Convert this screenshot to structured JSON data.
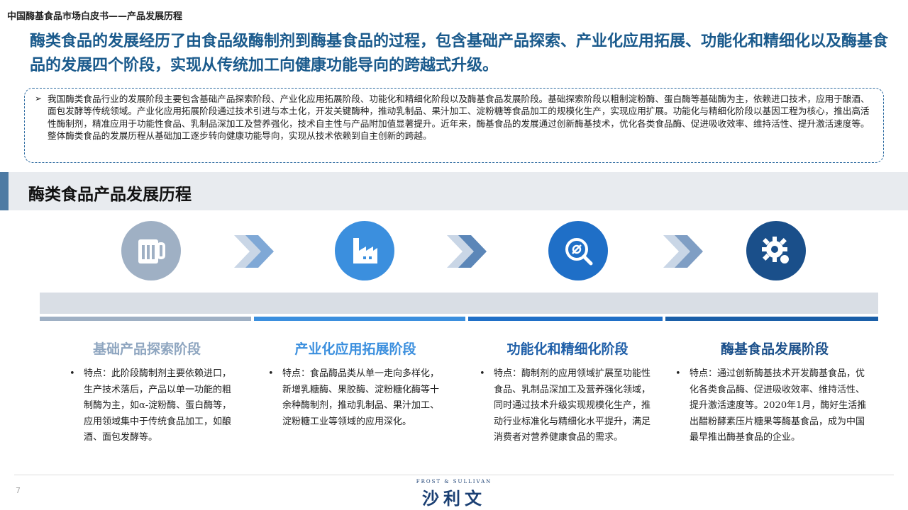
{
  "header": {
    "doc_title": "中国酶基食品市场白皮书——产品发展历程",
    "headline": "酶类食品的发展经历了由食品级酶制剂到酶基食品的过程，包含基础产品探索、产业化应用拓展、功能化和精细化以及酶基食品的发展四个阶段，实现从传统加工向健康功能导向的跨越式升级。"
  },
  "summary": {
    "arrow": "➢",
    "text": "我国酶类食品行业的发展阶段主要包含基础产品探索阶段、产业化应用拓展阶段、功能化和精细化阶段以及酶基食品发展阶段。基础探索阶段以粗制淀粉酶、蛋白酶等基础酶为主，依赖进口技术，应用于酿酒、面包发酵等传统领域。产业化应用拓展阶段通过技术引进与本土化，开发关键酶种，推动乳制品、果汁加工、淀粉糖等食品加工的规模化生产，实现应用扩展。功能化与精细化阶段以基因工程为核心，推出高活性酶制剂，精准应用于功能性食品、乳制品深加工及营养强化，技术自主性与产品附加值显著提升。近年来，酶基食品的发展通过创新酶基技术，优化各类食品酶、促进吸收效率、维持活性、提升激活速度等。整体酶类食品的发展历程从基础加工逐步转向健康功能导向，实现从技术依赖到自主创新的跨越。"
  },
  "section": {
    "title": "酶类食品产品发展历程"
  },
  "stages": [
    {
      "icon": "beer-mug-icon",
      "color": "#9fb0c4",
      "line_color": "#9fb0c4",
      "title": "基础产品探索阶段",
      "title_color": "#8fa6c0",
      "bullet": "•",
      "body": "特点：此阶段酶制剂主要依赖进口，生产技术落后，产品以单一功能的粗制酶为主，如α-淀粉酶、蛋白酶等，应用领域集中于传统食品加工，如酿酒、面包发酵等。"
    },
    {
      "icon": "factory-icon",
      "color": "#3b8fde",
      "line_color": "#3b8fde",
      "title": "产业化应用拓展阶段",
      "title_color": "#3b8fde",
      "bullet": "•",
      "body": "特点：食品酶品类从单一走向多样化，新增乳糖酶、果胶酶、淀粉糖化酶等十余种酶制剂，推动乳制品、果汁加工、淀粉糖工业等领域的应用深化。"
    },
    {
      "icon": "magnifier-icon",
      "color": "#1f6fc7",
      "line_color": "#1f6fc7",
      "title": "功能化和精细化阶段",
      "title_color": "#1f5fa8",
      "bullet": "•",
      "body": "特点：酶制剂的应用领域扩展至功能性食品、乳制品深加工及营养强化领域，同时通过技术升级实现规模化生产，推动行业标准化与精细化水平提升，满足消费者对营养健康食品的需求。"
    },
    {
      "icon": "gear-icon",
      "color": "#1a4f8a",
      "line_color": "#1a5fa8",
      "title": "酶基食品发展阶段",
      "title_color": "#1a4f8a",
      "bullet": "•",
      "body": "特点：通过创新酶基技术开发酶基食品，优化各类食品酶、促进吸收效率、维持活性、提升激活速度等。2020年1月，酶好生活推出醋粉酵素压片糖果等酶基食品，成为中国最早推出酶基食品的企业。"
    }
  ],
  "footer": {
    "page_number": "7",
    "logo_en": "FROST & SULLIVAN",
    "logo_cn": "沙利文"
  }
}
